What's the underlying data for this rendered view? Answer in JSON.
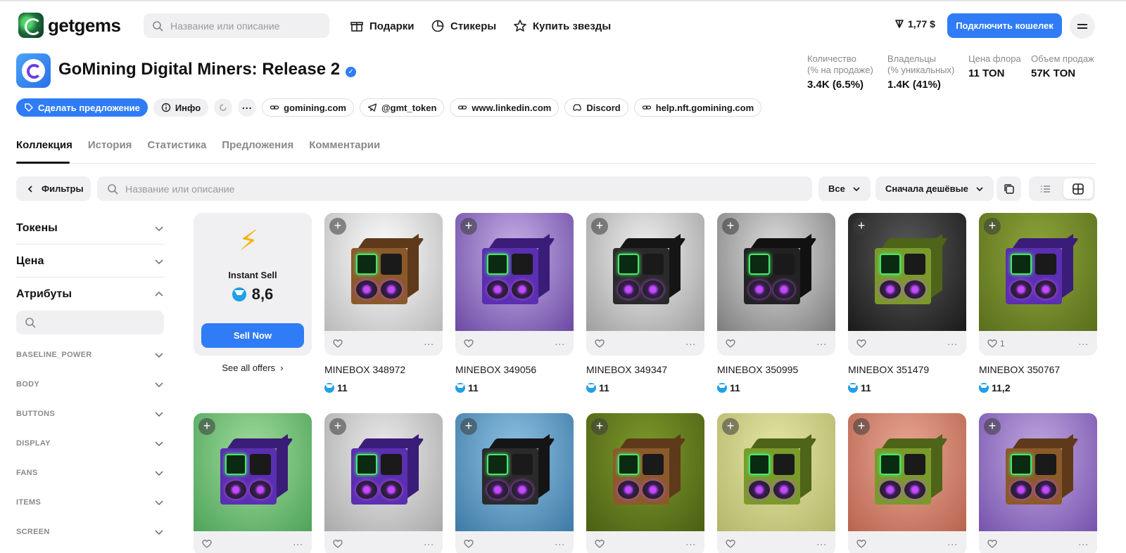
{
  "header": {
    "logo_text": "getgems",
    "search_placeholder": "Название или описание",
    "nav": [
      {
        "label": "Подарки",
        "icon": "gift-icon"
      },
      {
        "label": "Стикеры",
        "icon": "sticker-icon"
      },
      {
        "label": "Купить звезды",
        "icon": "star-icon"
      }
    ],
    "ton_price": "1,77 $",
    "connect_label": "Подключить кошелек"
  },
  "collection": {
    "title": "GoMining Digital Miners: Release 2",
    "stats": [
      {
        "label1": "Количество",
        "label2": "(% на продаже)",
        "value": "3.4K (6.5%)"
      },
      {
        "label1": "Владельцы",
        "label2": "(% уникальных)",
        "value": "1.4K (41%)"
      },
      {
        "label1": "Цена флора",
        "label2": "",
        "value": "11 TON"
      },
      {
        "label1": "Объем продаж",
        "label2": "",
        "value": "57K TON"
      }
    ],
    "offer_label": "Сделать предложение",
    "info_label": "Инфо",
    "links": [
      "gomining.com",
      "@gmt_token",
      "www.linkedin.com",
      "Discord",
      "help.nft.gomining.com"
    ]
  },
  "tabs": [
    "Коллекция",
    "История",
    "Статистика",
    "Предложения",
    "Комментарии"
  ],
  "toolbar": {
    "filters_label": "Фильтры",
    "search_placeholder": "Название или описание",
    "filter_all": "Все",
    "sort_label": "Сначала дешёвые"
  },
  "sidebar": {
    "groups": [
      "Токены",
      "Цена",
      "Атрибуты"
    ],
    "attributes": [
      "BASELINE_POWER",
      "BODY",
      "BUTTONS",
      "DISPLAY",
      "FANS",
      "ITEMS",
      "SCREEN"
    ]
  },
  "instant_sell": {
    "label": "Instant Sell",
    "price": "8,6",
    "button": "Sell Now",
    "see_all": "See all offers"
  },
  "cards_row1": [
    {
      "name": "MINEBOX 348972",
      "price": "11",
      "likes": "",
      "bg": [
        "#ffffff",
        "#b9b9b9"
      ],
      "body": "#8b5a2b",
      "side": "#5e3a1a"
    },
    {
      "name": "MINEBOX 349056",
      "price": "11",
      "likes": "",
      "bg": [
        "#c9b3e8",
        "#6b49a3"
      ],
      "body": "#5a2fb0",
      "side": "#3a1d78"
    },
    {
      "name": "MINEBOX 349347",
      "price": "11",
      "likes": "",
      "bg": [
        "#f2f2f2",
        "#9e9e9e"
      ],
      "body": "#2a2a2a",
      "side": "#151515"
    },
    {
      "name": "MINEBOX 350995",
      "price": "11",
      "likes": "",
      "bg": [
        "#e0e0e0",
        "#7d7d7d"
      ],
      "body": "#222222",
      "side": "#111111"
    },
    {
      "name": "MINEBOX 351479",
      "price": "11",
      "likes": "",
      "bg": [
        "#5a5a5a",
        "#1a1a1a"
      ],
      "body": "#7a9a2b",
      "side": "#4e6418"
    },
    {
      "name": "MINEBOX 350767",
      "price": "11,2",
      "likes": "1",
      "bg": [
        "#8ea63a",
        "#5a6e1c"
      ],
      "body": "#5a2fb0",
      "side": "#3a1d78"
    }
  ],
  "cards_row2": [
    {
      "bg": [
        "#9fdc9a",
        "#4ea35a"
      ],
      "body": "#5a2fb0",
      "side": "#3a1d78"
    },
    {
      "bg": [
        "#ededed",
        "#a9a9a9"
      ],
      "body": "#5a2fb0",
      "side": "#3a1d78"
    },
    {
      "bg": [
        "#8fc3e4",
        "#3e7aa6"
      ],
      "body": "#2a2a2a",
      "side": "#151515"
    },
    {
      "bg": [
        "#7d9a2a",
        "#4c5f15"
      ],
      "body": "#8b5a2b",
      "side": "#5e3a1a"
    },
    {
      "bg": [
        "#e5e6a6",
        "#b3b66a"
      ],
      "body": "#7a9a2b",
      "side": "#4e6418"
    },
    {
      "bg": [
        "#e9a895",
        "#b8644f"
      ],
      "body": "#7a9a2b",
      "side": "#4e6418"
    },
    {
      "bg": [
        "#c1a8e0",
        "#7653ad"
      ],
      "body": "#8b5a2b",
      "side": "#5e3a1a"
    }
  ]
}
